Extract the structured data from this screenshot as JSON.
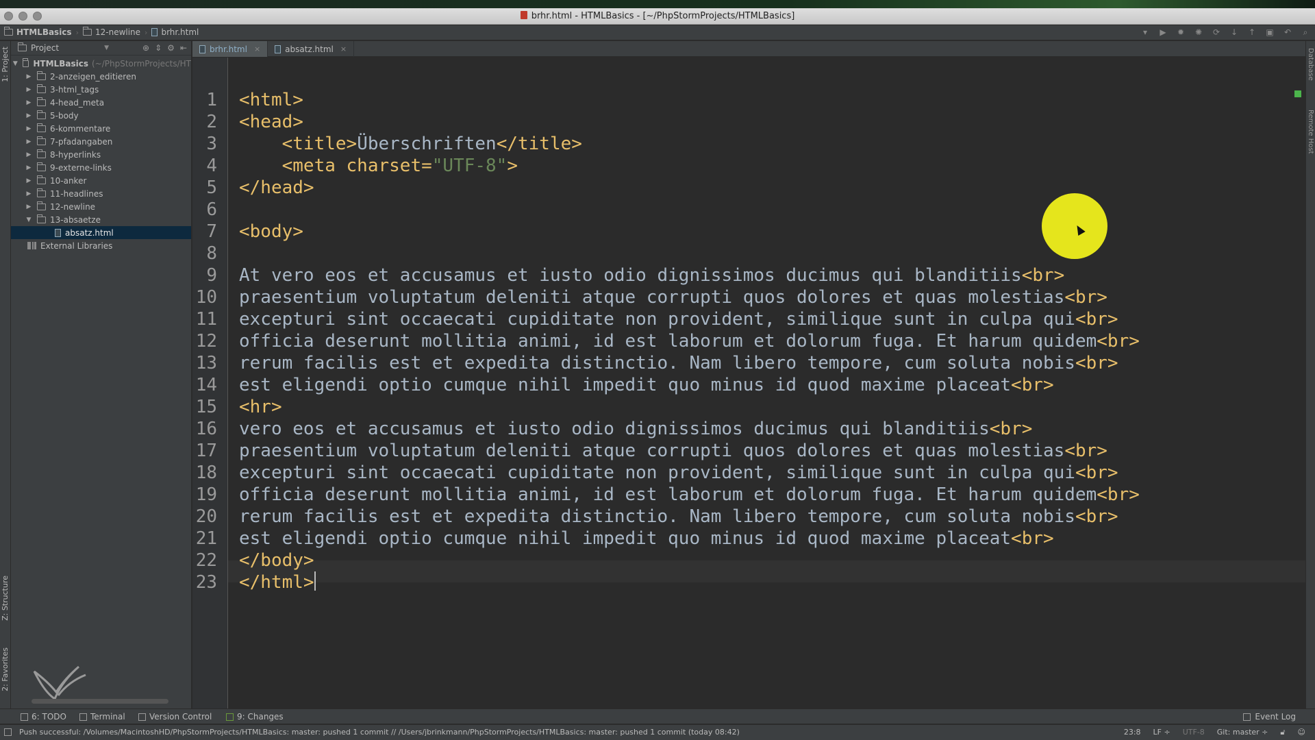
{
  "window": {
    "title": "brhr.html - HTMLBasics - [~/PhpStormProjects/HTMLBasics]"
  },
  "navbar": {
    "crumbs": [
      "HTMLBasics",
      "12-newline",
      "brhr.html"
    ]
  },
  "project_panel": {
    "title": "Project",
    "root": "HTMLBasics",
    "root_hint": "(~/PhpStormProjects/HT",
    "items": [
      "2-anzeigen_editieren",
      "3-html_tags",
      "4-head_meta",
      "5-body",
      "6-kommentare",
      "7-pfadangaben",
      "8-hyperlinks",
      "9-externe-links",
      "10-anker",
      "11-headlines",
      "12-newline",
      "13-absaetze"
    ],
    "child": "absatz.html",
    "external": "External Libraries"
  },
  "side_tools": {
    "project": "1: Project",
    "structure": "Z: Structure",
    "favorites": "2: Favorites",
    "database": "Database",
    "remote_host": "Remote Host"
  },
  "tabs": [
    {
      "label": "brhr.html",
      "active": true
    },
    {
      "label": "absatz.html",
      "active": false
    }
  ],
  "editor": {
    "lines": [
      "1",
      "2",
      "3",
      "4",
      "5",
      "6",
      "7",
      "8",
      "9",
      "10",
      "11",
      "12",
      "13",
      "14",
      "15",
      "16",
      "17",
      "18",
      "19",
      "20",
      "21",
      "22",
      "23"
    ],
    "code": {
      "l1": "<html>",
      "l2": "<head>",
      "l3a": "    <title>",
      "l3b": "Überschriften",
      "l3c": "</title>",
      "l4a": "    <meta charset=",
      "l4b": "\"UTF-8\"",
      "l4c": ">",
      "l5": "</head>",
      "l7": "<body>",
      "l9a": "At vero eos et accusamus et iusto odio dignissimos ducimus qui blanditiis",
      "l10a": "praesentium voluptatum deleniti atque corrupti quos dolores et quas molestias",
      "l11a": "excepturi sint occaecati cupiditate non provident, similique sunt in culpa qui",
      "l12a": "officia deserunt mollitia animi, id est laborum et dolorum fuga. Et harum quidem",
      "l13a": "rerum facilis est et expedita distinctio. Nam libero tempore, cum soluta nobis",
      "l14a": "est eligendi optio cumque nihil impedit quo minus id quod maxime placeat",
      "l15": "<hr>",
      "l16a": "vero eos et accusamus et iusto odio dignissimos ducimus qui blanditiis",
      "l17a": "praesentium voluptatum deleniti atque corrupti quos dolores et quas molestias",
      "l18a": "excepturi sint occaecati cupiditate non provident, similique sunt in culpa qui",
      "l19a": "officia deserunt mollitia animi, id est laborum et dolorum fuga. Et harum quidem",
      "l20a": "rerum facilis est et expedita distinctio. Nam libero tempore, cum soluta nobis",
      "l21a": "est eligendi optio cumque nihil impedit quo minus id quod maxime placeat",
      "br": "<br>",
      "l22": "</body>",
      "l23": "</html>"
    }
  },
  "bottom_tools": {
    "todo": "6: TODO",
    "terminal": "Terminal",
    "vcs": "Version Control",
    "changes": "9: Changes",
    "event_log": "Event Log"
  },
  "status": {
    "message": "Push successful: /Volumes/MacintoshHD/PhpStormProjects/HTMLBasics: master: pushed 1 commit // /Users/jbrinkmann/PhpStormProjects/HTMLBasics: master: pushed 1 commit (today 08:42)",
    "position": "23:8",
    "line_sep": "LF ÷",
    "encoding": "UTF-8",
    "git": "Git: master ÷"
  },
  "colors": {
    "tag": "#e8bf6a",
    "string": "#6a8759",
    "text": "#a9b7c6",
    "background": "#2b2b2b",
    "cursor_highlight": "#e5e51c"
  }
}
